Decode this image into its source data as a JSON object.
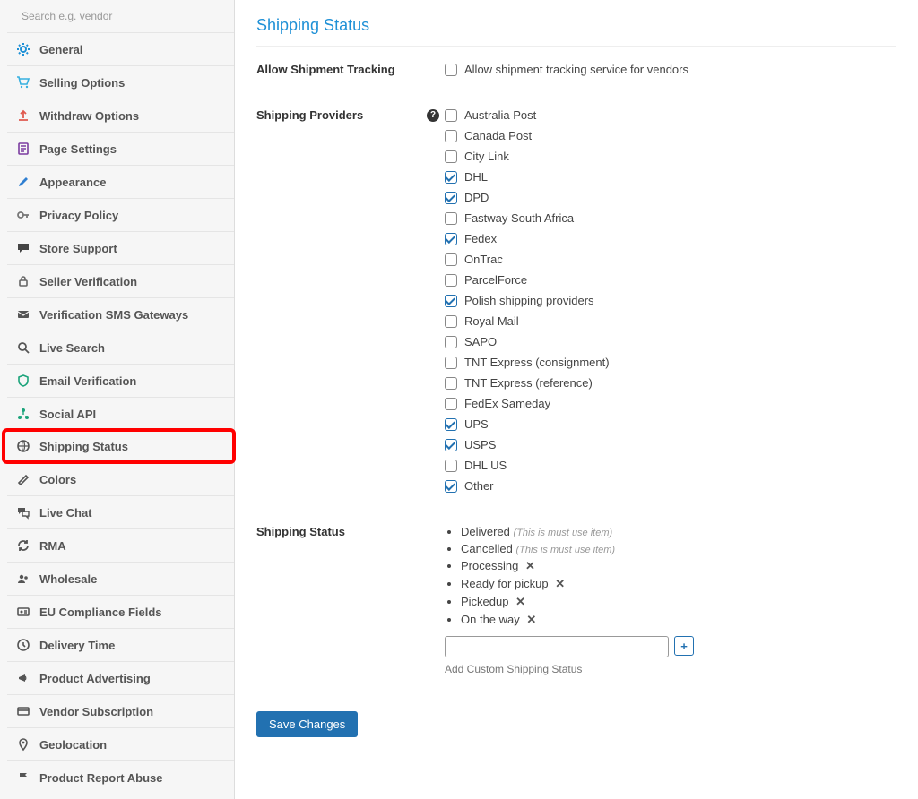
{
  "search": {
    "placeholder": "Search e.g. vendor"
  },
  "sidebar": {
    "items": [
      {
        "label": "General",
        "icon": "gear-icon",
        "color": "#1e90d6"
      },
      {
        "label": "Selling Options",
        "icon": "cart-icon",
        "color": "#37b0e0"
      },
      {
        "label": "Withdraw Options",
        "icon": "upload-icon",
        "color": "#e05a4f"
      },
      {
        "label": "Page Settings",
        "icon": "page-icon",
        "color": "#7b3ca0"
      },
      {
        "label": "Appearance",
        "icon": "brush-icon",
        "color": "#2f7fd1"
      },
      {
        "label": "Privacy Policy",
        "icon": "key-icon",
        "color": "#777"
      },
      {
        "label": "Store Support",
        "icon": "chat-icon",
        "color": "#444"
      },
      {
        "label": "Seller Verification",
        "icon": "lock-icon",
        "color": "#666"
      },
      {
        "label": "Verification SMS Gateways",
        "icon": "mail-icon",
        "color": "#555"
      },
      {
        "label": "Live Search",
        "icon": "search-icon",
        "color": "#555"
      },
      {
        "label": "Email Verification",
        "icon": "shield-icon",
        "color": "#1aa37a"
      },
      {
        "label": "Social API",
        "icon": "network-icon",
        "color": "#1aa37a"
      },
      {
        "label": "Shipping Status",
        "icon": "globe-icon",
        "color": "#555",
        "active": true
      },
      {
        "label": "Colors",
        "icon": "paint-icon",
        "color": "#555"
      },
      {
        "label": "Live Chat",
        "icon": "chats-icon",
        "color": "#555"
      },
      {
        "label": "RMA",
        "icon": "refresh-icon",
        "color": "#555"
      },
      {
        "label": "Wholesale",
        "icon": "users-icon",
        "color": "#555"
      },
      {
        "label": "EU Compliance Fields",
        "icon": "id-icon",
        "color": "#555"
      },
      {
        "label": "Delivery Time",
        "icon": "clock-icon",
        "color": "#555"
      },
      {
        "label": "Product Advertising",
        "icon": "megaphone-icon",
        "color": "#555"
      },
      {
        "label": "Vendor Subscription",
        "icon": "card-icon",
        "color": "#555"
      },
      {
        "label": "Geolocation",
        "icon": "pin-icon",
        "color": "#555"
      },
      {
        "label": "Product Report Abuse",
        "icon": "flag-icon",
        "color": "#555"
      }
    ]
  },
  "main": {
    "title": "Shipping Status",
    "allow_tracking": {
      "label": "Allow Shipment Tracking",
      "option_label": "Allow shipment tracking service for vendors",
      "checked": false
    },
    "providers": {
      "label": "Shipping Providers",
      "items": [
        {
          "label": "Australia Post",
          "checked": false
        },
        {
          "label": "Canada Post",
          "checked": false
        },
        {
          "label": "City Link",
          "checked": false
        },
        {
          "label": "DHL",
          "checked": true
        },
        {
          "label": "DPD",
          "checked": true
        },
        {
          "label": "Fastway South Africa",
          "checked": false
        },
        {
          "label": "Fedex",
          "checked": true
        },
        {
          "label": "OnTrac",
          "checked": false
        },
        {
          "label": "ParcelForce",
          "checked": false
        },
        {
          "label": "Polish shipping providers",
          "checked": true
        },
        {
          "label": "Royal Mail",
          "checked": false
        },
        {
          "label": "SAPO",
          "checked": false
        },
        {
          "label": "TNT Express (consignment)",
          "checked": false
        },
        {
          "label": "TNT Express (reference)",
          "checked": false
        },
        {
          "label": "FedEx Sameday",
          "checked": false
        },
        {
          "label": "UPS",
          "checked": true
        },
        {
          "label": "USPS",
          "checked": true
        },
        {
          "label": "DHL US",
          "checked": false
        },
        {
          "label": "Other",
          "checked": true
        }
      ]
    },
    "status": {
      "label": "Shipping Status",
      "must_use_note": "(This is must use item)",
      "items": [
        {
          "label": "Delivered",
          "must_use": true
        },
        {
          "label": "Cancelled",
          "must_use": true
        },
        {
          "label": "Processing",
          "removable": true
        },
        {
          "label": "Ready for pickup",
          "removable": true
        },
        {
          "label": "Pickedup",
          "removable": true
        },
        {
          "label": "On the way",
          "removable": true
        }
      ],
      "add_help": "Add Custom Shipping Status"
    },
    "save_label": "Save Changes"
  }
}
